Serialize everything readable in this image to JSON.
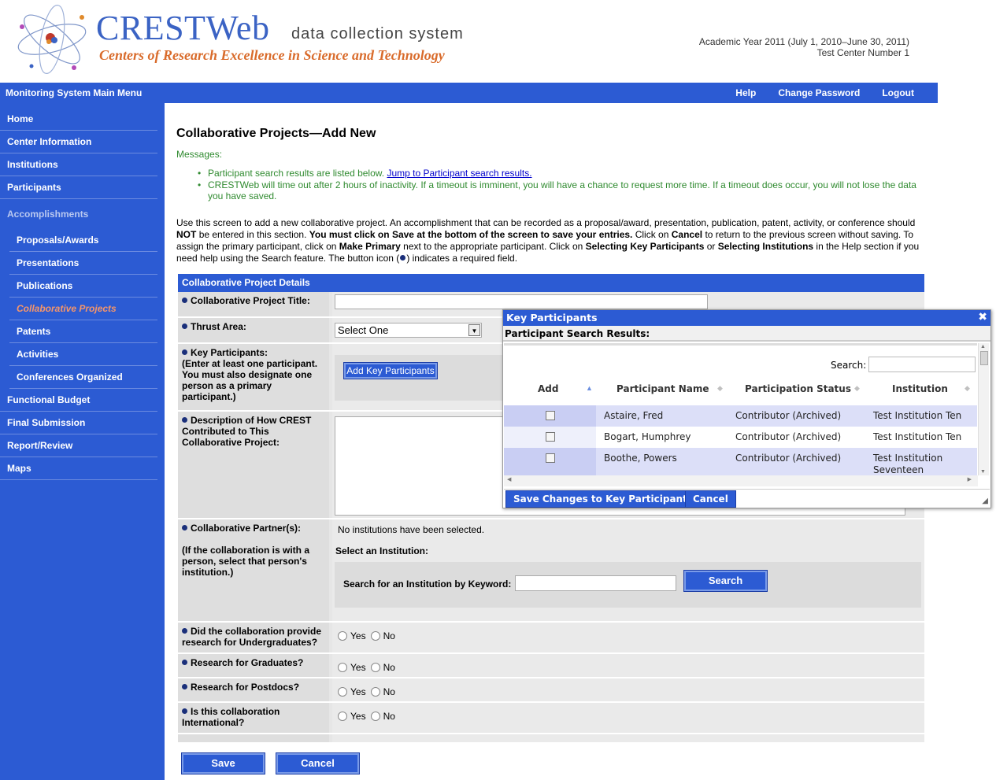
{
  "header": {
    "logo_title": "CRESTWeb",
    "logo_subtitle": "data collection system",
    "logo_tagline": "Centers of Research Excellence in Science and Technology",
    "academic_year": "Academic Year 2011 (July 1, 2010–June 30, 2011)",
    "center": "Test Center Number 1"
  },
  "topbar": {
    "menu_title": "Monitoring System Main Menu",
    "help": "Help",
    "change_password": "Change Password",
    "logout": "Logout"
  },
  "sidebar": {
    "home": "Home",
    "center_information": "Center Information",
    "institutions": "Institutions",
    "participants": "Participants",
    "accomplishments": "Accomplishments",
    "proposals": "Proposals/Awards",
    "presentations": "Presentations",
    "publications": "Publications",
    "collaborative": "Collaborative Projects",
    "patents": "Patents",
    "activities": "Activities",
    "conferences": "Conferences Organized",
    "budget": "Functional Budget",
    "final": "Final Submission",
    "report": "Report/Review",
    "maps": "Maps"
  },
  "main": {
    "title": "Collaborative Projects—Add New",
    "messages_label": "Messages:",
    "msg1_text": "Participant search results are listed below.",
    "msg1_link": "Jump to Participant search results.",
    "msg2": "CRESTWeb will time out after 2 hours of inactivity. If a timeout is imminent, you will have a chance to request more time. If a timeout does occur, you will not lose the data you have saved.",
    "intro_1": "Use this screen to add a new collaborative project. An accomplishment that can be recorded as a proposal/award, presentation, publication, patent, activity, or conference should",
    "intro_not": "NOT",
    "intro_2": "be entered in this section.",
    "intro_must": "You must click on",
    "intro_save": "Save",
    "intro_3": "at the bottom of the screen to save your entries.",
    "intro_4": "Click on",
    "intro_cancel": "Cancel",
    "intro_5": "to return to the previous screen without saving. To assign the primary participant, click on",
    "intro_make_primary": "Make Primary",
    "intro_6": "next to the appropriate participant. Click on",
    "intro_selecting_kp": "Selecting Key Participants",
    "intro_or": "or",
    "intro_selecting_inst": "Selecting Institutions",
    "intro_7": "in the Help section if you need help using the Search feature. The button icon (",
    "intro_8": ") indicates a required field."
  },
  "form": {
    "section_title": "Collaborative Project Details",
    "title_label": "Collaborative Project Title:",
    "thrust_label": "Thrust Area:",
    "thrust_value": "Select One",
    "key_label": "Key Participants:",
    "key_note": "(Enter at least one participant. You must also designate one person as a primary participant.)",
    "add_key_btn": "Add Key Participants",
    "desc_label": "Description of How CREST Contributed to This Collaborative Project:",
    "partner_label": "Collaborative Partner(s):",
    "partner_note": "(If the collaboration is with a person, select that person's institution.)",
    "no_institutions": "No institutions have been selected.",
    "select_institution": "Select an Institution:",
    "search_keyword_label": "Search for an Institution by Keyword:",
    "search_btn": "Search",
    "undergrad_label": "Did the collaboration provide research for Undergraduates?",
    "grad_label": "Research for Graduates?",
    "postdoc_label": "Research for Postdocs?",
    "intl_label": "Is this collaboration International?",
    "yes": "Yes",
    "no": "No",
    "save_btn": "Save",
    "cancel_btn": "Cancel"
  },
  "dialog": {
    "title": "Key Participants",
    "close": "✖",
    "subtitle": "Participant Search Results:",
    "search_label": "Search:",
    "col_add": "Add",
    "col_name": "Participant Name",
    "col_status": "Participation Status",
    "col_inst": "Institution",
    "rows": [
      {
        "name": "Astaire, Fred",
        "status": "Contributor (Archived)",
        "inst": "Test Institution Ten",
        "inst2": ""
      },
      {
        "name": "Bogart, Humphrey",
        "status": "Contributor (Archived)",
        "inst": "Test Institution Ten",
        "inst2": ""
      },
      {
        "name": "Boothe, Powers",
        "status": "Contributor (Archived)",
        "inst": "Test Institution",
        "inst2": "Seventeen"
      }
    ],
    "save_btn": "Save Changes to Key Participants",
    "cancel_btn": "Cancel"
  },
  "colors": {
    "primary_blue": "#2c5bd3",
    "message_green": "#2f8a2f",
    "active_nav": "#f4956b"
  }
}
